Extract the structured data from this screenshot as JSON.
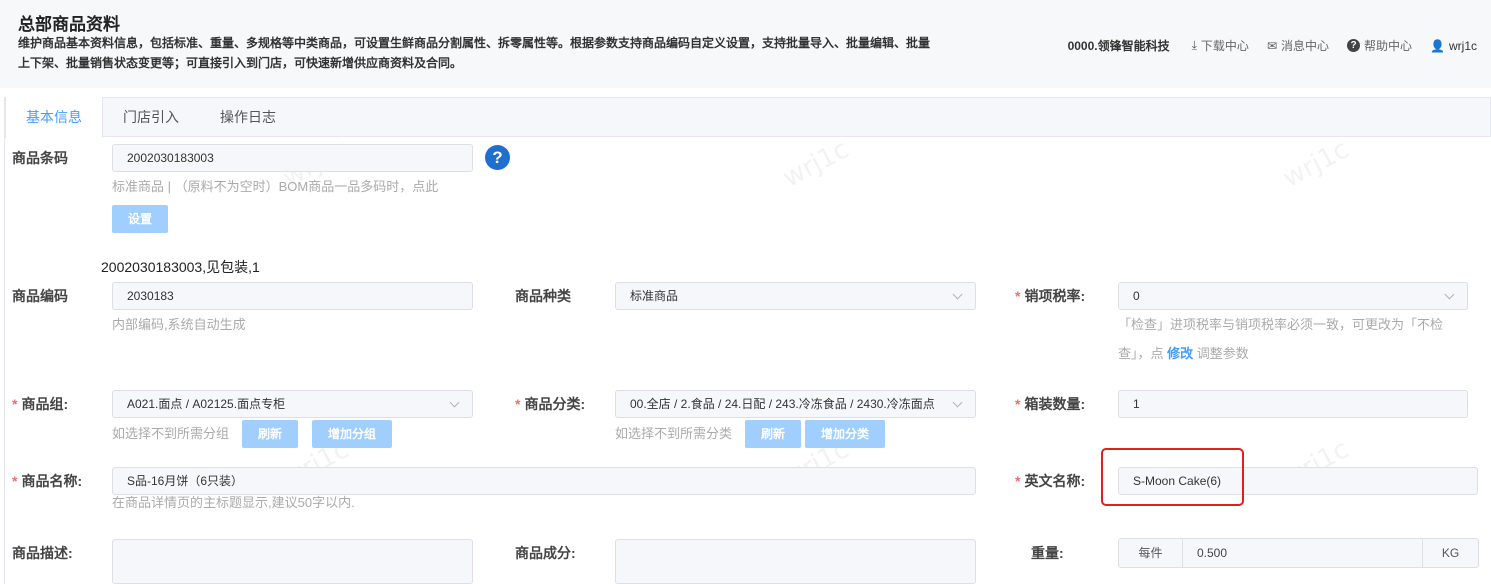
{
  "header": {
    "title": "总部商品资料",
    "description": "维护商品基本资料信息，包括标准、重量、多规格等中类商品，可设置生鲜商品分割属性、拆零属性等。根据参数支持商品编码自定义设置，支持批量导入、批量编辑、批量上下架、批量销售状态变更等；可直接引入到门店，可快速新增供应商资料及合同。",
    "company": "0000.领锋智能科技",
    "download": "下载中心",
    "messages": "消息中心",
    "help": "帮助中心",
    "user": "wrj1c",
    "icons": {
      "download": "download-icon",
      "messages": "mail-icon",
      "help": "question-circle-icon",
      "user": "user-icon"
    }
  },
  "tabs": [
    {
      "label": "基本信息",
      "active": true
    },
    {
      "label": "门店引入",
      "active": false
    },
    {
      "label": "操作日志",
      "active": false
    }
  ],
  "watermark": "wrj1c",
  "form": {
    "barcode": {
      "label": "商品条码",
      "value": "2002030183003",
      "hint": "标准商品 | （原料不为空时）BOM商品一品多码时，点此",
      "set_button": "设置",
      "summary": "2002030183003,见包装,1"
    },
    "code": {
      "label": "商品编码",
      "value": "2030183",
      "hint": "内部编码,系统自动生成"
    },
    "kind": {
      "label": "商品种类",
      "value": "标准商品"
    },
    "tax": {
      "label": "销项税率:",
      "value": "0",
      "hint_line1": "「检查」进项税率与销项税率必须一致，可更改为「不检",
      "hint_line2_pre": "查」，点 ",
      "hint_link": "修改",
      "hint_line2_post": " 调整参数"
    },
    "group": {
      "label": "商品组:",
      "value": "A021.面点 / A02125.面点专柜",
      "hint": "如选择不到所需分组",
      "refresh": "刷新",
      "add": "增加分组"
    },
    "category": {
      "label": "商品分类:",
      "value": "00.全店 / 2.食品 / 24.日配 / 243.冷冻食品 / 2430.冷冻面点",
      "hint": "如选择不到所需分类",
      "refresh": "刷新",
      "add": "增加分类"
    },
    "box_qty": {
      "label": "箱装数量:",
      "value": "1"
    },
    "name": {
      "label": "商品名称:",
      "value": "S品-16月饼（6只装）",
      "hint": "在商品详情页的主标题显示,建议50字以内."
    },
    "english_name": {
      "label": "英文名称:",
      "value": "S-Moon Cake(6)"
    },
    "description": {
      "label": "商品描述:"
    },
    "ingredients": {
      "label": "商品成分:"
    },
    "weight": {
      "label": "重量:",
      "prefix": "每件",
      "value": "0.500",
      "unit": "KG"
    }
  }
}
